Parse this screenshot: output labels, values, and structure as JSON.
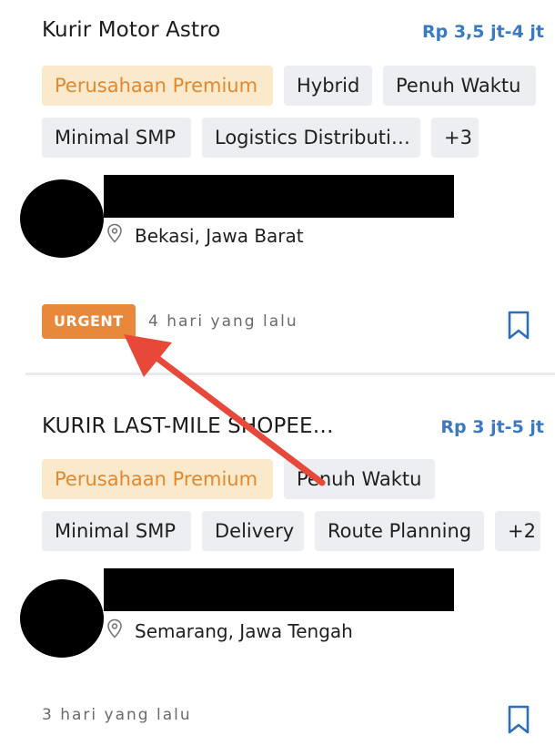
{
  "jobs": [
    {
      "title": "Kurir Motor Astro",
      "salary": "Rp 3,5 jt-4 jt",
      "tags_row1": [
        "Perusahaan Premium",
        "Hybrid",
        "Penuh Waktu"
      ],
      "tags_row2": [
        "Minimal SMP",
        "Logistics Distributi…",
        "+3"
      ],
      "location": "Bekasi, Jawa Barat",
      "badge": "URGENT",
      "posted": "4 hari yang lalu"
    },
    {
      "title": "KURIR LAST-MILE SHOPEE…",
      "salary": "Rp 3 jt-5 jt",
      "tags_row1": [
        "Perusahaan Premium",
        "Penuh Waktu"
      ],
      "tags_row2": [
        "Minimal SMP",
        "Delivery",
        "Route Planning",
        "+2"
      ],
      "location": "Semarang, Jawa Tengah",
      "posted": "3 hari yang lalu"
    }
  ],
  "colors": {
    "accent_blue": "#3a7ac2",
    "premium_bg": "#fbe9cc",
    "premium_text": "#e3882f",
    "urgent_bg": "#e8883a",
    "annotation_arrow": "#e8483a"
  }
}
